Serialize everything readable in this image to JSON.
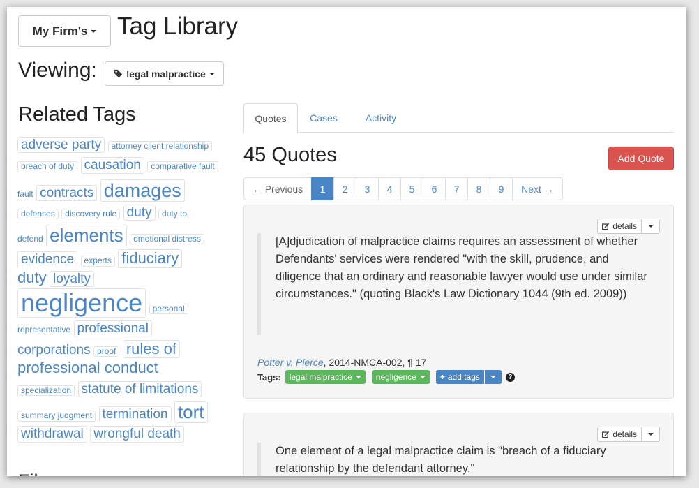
{
  "header": {
    "firm_button": "My Firm's",
    "title": "Tag Library",
    "viewing_label": "Viewing:",
    "viewing_tag": "legal malpractice"
  },
  "related": {
    "title": "Related Tags",
    "tags": [
      "adverse party",
      "attorney client relationship",
      "breach of duty",
      "causation",
      "comparative fault",
      "contracts",
      "damages",
      "defenses",
      "discovery rule",
      "duty",
      "duty to defend",
      "elements",
      "emotional distress",
      "evidence",
      "experts",
      "fiduciary duty",
      "loyalty",
      "negligence",
      "personal representative",
      "professional corporations",
      "proof",
      "rules of professional conduct",
      "specialization",
      "statute of limitations",
      "summary judgment",
      "termination",
      "tort",
      "withdrawal",
      "wrongful death"
    ],
    "next_heading_partial": "Fil"
  },
  "tabs": [
    "Quotes",
    "Cases",
    "Activity"
  ],
  "quotes": {
    "count_label": "45 Quotes",
    "add_button": "Add Quote"
  },
  "pagination": {
    "prev": "← Previous",
    "pages": [
      "1",
      "2",
      "3",
      "4",
      "5",
      "6",
      "7",
      "8",
      "9"
    ],
    "current": "1",
    "next": "Next →"
  },
  "cards": [
    {
      "details": "details",
      "text": "[A]djudication of malpractice claims requires an assessment of whether Defendants' services were rendered \"with the skill, prudence, and diligence that an ordinary and reasonable lawyer would use under similar circumstances.\" (quoting Black's Law Dictionary 1044 (9th ed. 2009))",
      "case_name": "Potter v. Pierce",
      "citation_rest": ", 2014-NMCA-002, ¶ 17",
      "tags_label": "Tags:",
      "tags": [
        "legal malpractice",
        "negligence"
      ],
      "add_tags": "add tags",
      "help": "?"
    },
    {
      "details": "details",
      "text": "One element of a legal malpractice claim is \"breach of a fiduciary relationship by the defendant attorney.\""
    }
  ],
  "colors": {
    "link": "#4a86c5",
    "danger": "#d9534f",
    "success": "#5cb85c",
    "primary": "#4a86c5"
  }
}
